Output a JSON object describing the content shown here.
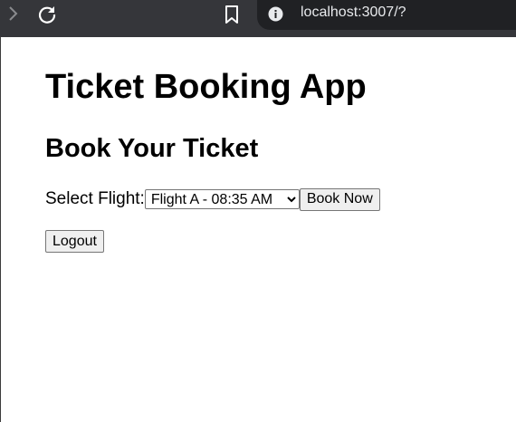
{
  "browser": {
    "url": "localhost:3007/?"
  },
  "page": {
    "title": "Ticket Booking App",
    "section_title": "Book Your Ticket",
    "select_label": "Select Flight:",
    "flight_options": [
      "Flight A - 08:35 AM"
    ],
    "selected_flight": "Flight A - 08:35 AM",
    "book_button": "Book Now",
    "logout_button": "Logout"
  }
}
